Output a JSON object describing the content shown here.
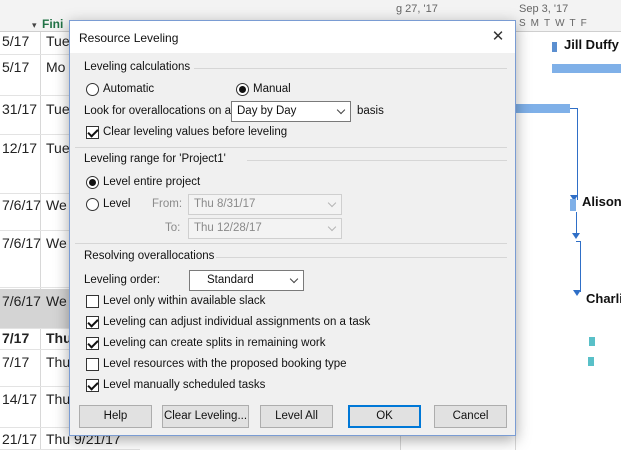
{
  "background": {
    "finish_header": "Fini",
    "sort_arrow": "▾",
    "timescale": [
      "g 27, '17",
      "Sep 3, '17"
    ],
    "day_letters": "SMTWTF",
    "rows": [
      {
        "c1": "5/17",
        "c2": "Tue"
      },
      {
        "c1": "5/17",
        "c2": "Mo"
      },
      {
        "c1": "31/17",
        "c2": "Tue"
      },
      {
        "c1": "12/17",
        "c2": "Tue"
      },
      {
        "c1": "7/6/17",
        "c2": "We"
      },
      {
        "c1": "7/6/17",
        "c2": "We"
      },
      {
        "c1": "7/6/17",
        "c2": "We"
      },
      {
        "c1": "7/17",
        "c2": "Thu"
      },
      {
        "c1": "7/17",
        "c2": "Thu"
      },
      {
        "c1": "14/17",
        "c2": "Thu"
      },
      {
        "c1": "21/17",
        "c2": "Thu 9/21/17"
      }
    ],
    "gantt_labels": [
      "Jill Duffy",
      "Alison",
      "Charli"
    ]
  },
  "dialog": {
    "title": "Resource Leveling",
    "close_icon": "close-icon",
    "calc": {
      "group_title": "Leveling calculations",
      "automatic_label": "Automatic",
      "manual_label": "Manual",
      "selected": "manual",
      "overalloc_prefix": "Look for overallocations on a",
      "basis_value": "Day by Day",
      "overalloc_suffix": "basis",
      "clear_values_label": "Clear leveling values before leveling",
      "clear_values_checked": true
    },
    "range": {
      "group_title": "Leveling range for 'Project1'",
      "entire_label": "Level entire project",
      "level_label": "Level",
      "from_label": "From:",
      "from_value": "Thu 8/31/17",
      "to_label": "To:",
      "to_value": "Thu 12/28/17",
      "selected": "entire"
    },
    "resolve": {
      "group_title": "Resolving overallocations",
      "order_label": "Leveling order:",
      "order_value": "Standard",
      "options": [
        {
          "label": "Level only within available slack",
          "checked": false
        },
        {
          "label": "Leveling can adjust individual assignments on a task",
          "checked": true
        },
        {
          "label": "Leveling can create splits in remaining work",
          "checked": true
        },
        {
          "label": "Level resources with the proposed booking type",
          "checked": false
        },
        {
          "label": "Level manually scheduled tasks",
          "checked": true
        }
      ]
    },
    "buttons": {
      "help": "Help",
      "clear": "Clear Leveling...",
      "level_all": "Level All",
      "ok": "OK",
      "cancel": "Cancel"
    }
  }
}
